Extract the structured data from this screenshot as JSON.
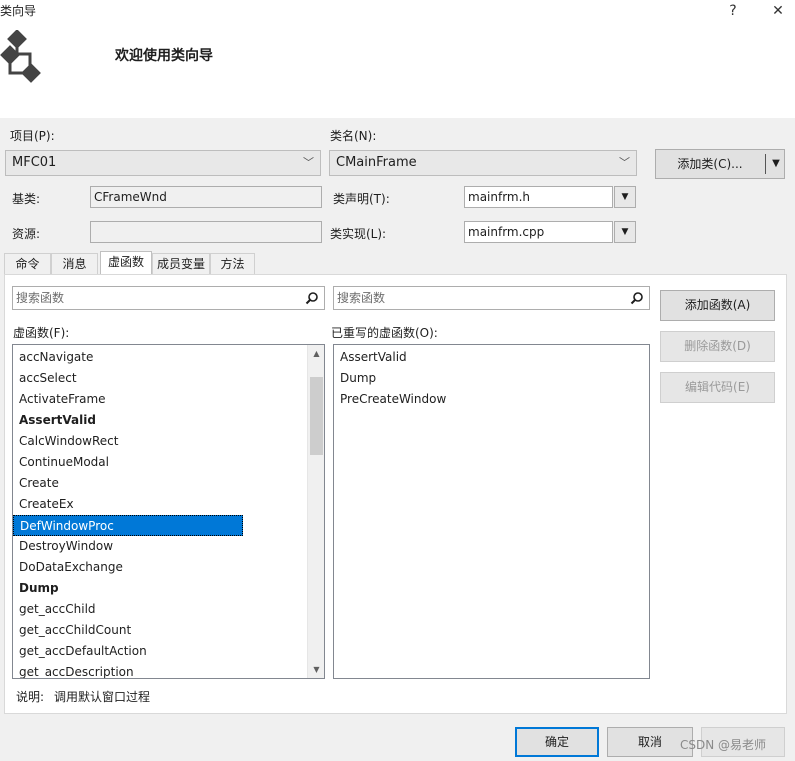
{
  "window": {
    "title": "类向导",
    "help_glyph": "?",
    "close_glyph": "✕"
  },
  "header": {
    "title": "欢迎使用类向导",
    "icon": "wizard-diagram-icon"
  },
  "form": {
    "project_label": "项目(P):",
    "project_value": "MFC01",
    "classname_label": "类名(N):",
    "classname_value": "CMainFrame",
    "add_class_label": "添加类(C)...",
    "base_label": "基类:",
    "base_value": "CFrameWnd",
    "decl_label": "类声明(T):",
    "decl_value": "mainfrm.h",
    "resource_label": "资源:",
    "resource_value": "",
    "impl_label": "类实现(L):",
    "impl_value": "mainfrm.cpp"
  },
  "tabs": [
    {
      "label": "命令"
    },
    {
      "label": "消息"
    },
    {
      "label": "虚函数"
    },
    {
      "label": "成员变量"
    },
    {
      "label": "方法"
    }
  ],
  "virtuals": {
    "search_placeholder_left": "搜索函数",
    "search_placeholder_right": "搜索函数",
    "list_label": "虚函数(F):",
    "overridden_label": "已重写的虚函数(O):",
    "list_items": [
      "accNavigate",
      "accSelect",
      "ActivateFrame",
      "AssertValid",
      "CalcWindowRect",
      "ContinueModal",
      "Create",
      "CreateEx",
      "DefWindowProc",
      "DestroyWindow",
      "DoDataExchange",
      "Dump",
      "get_accChild",
      "get_accChildCount",
      "get_accDefaultAction",
      "get_accDescription"
    ],
    "overridden_items": [
      "AssertValid",
      "Dump",
      "PreCreateWindow"
    ],
    "add_func_label": "添加函数(A)",
    "delete_func_label": "删除函数(D)",
    "edit_code_label": "编辑代码(E)",
    "description_label": "说明:",
    "description_value": "调用默认窗口过程"
  },
  "footer": {
    "ok_label": "确定",
    "cancel_label": "取消",
    "watermark": "CSDN @易老师"
  },
  "colors": {
    "selection": "#0078d7",
    "dialog_bg": "#f0f0f0"
  }
}
